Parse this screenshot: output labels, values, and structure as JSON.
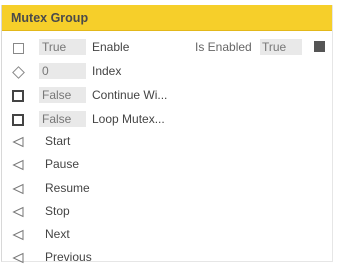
{
  "node": {
    "title": "Mutex Group",
    "header_color": "#f6cf2a"
  },
  "inputs": [
    {
      "pin": "checkbox-empty",
      "value": "True",
      "label": "Enable"
    },
    {
      "pin": "diamond",
      "value": "0",
      "label": "Index"
    },
    {
      "pin": "checkbox-bold",
      "value": "False",
      "label": "Continue Wi..."
    },
    {
      "pin": "checkbox-bold",
      "value": "False",
      "label": "Loop Mutex..."
    }
  ],
  "outputs": [
    {
      "label": "Is Enabled",
      "value": "True",
      "pin": "square-filled"
    }
  ],
  "exec_inputs": [
    {
      "pin": "triangle-left",
      "label": "Start"
    },
    {
      "pin": "triangle-left",
      "label": "Pause"
    },
    {
      "pin": "triangle-left",
      "label": "Resume"
    },
    {
      "pin": "triangle-left",
      "label": "Stop"
    },
    {
      "pin": "triangle-left",
      "label": "Next"
    },
    {
      "pin": "triangle-left",
      "label": "Previous"
    }
  ]
}
